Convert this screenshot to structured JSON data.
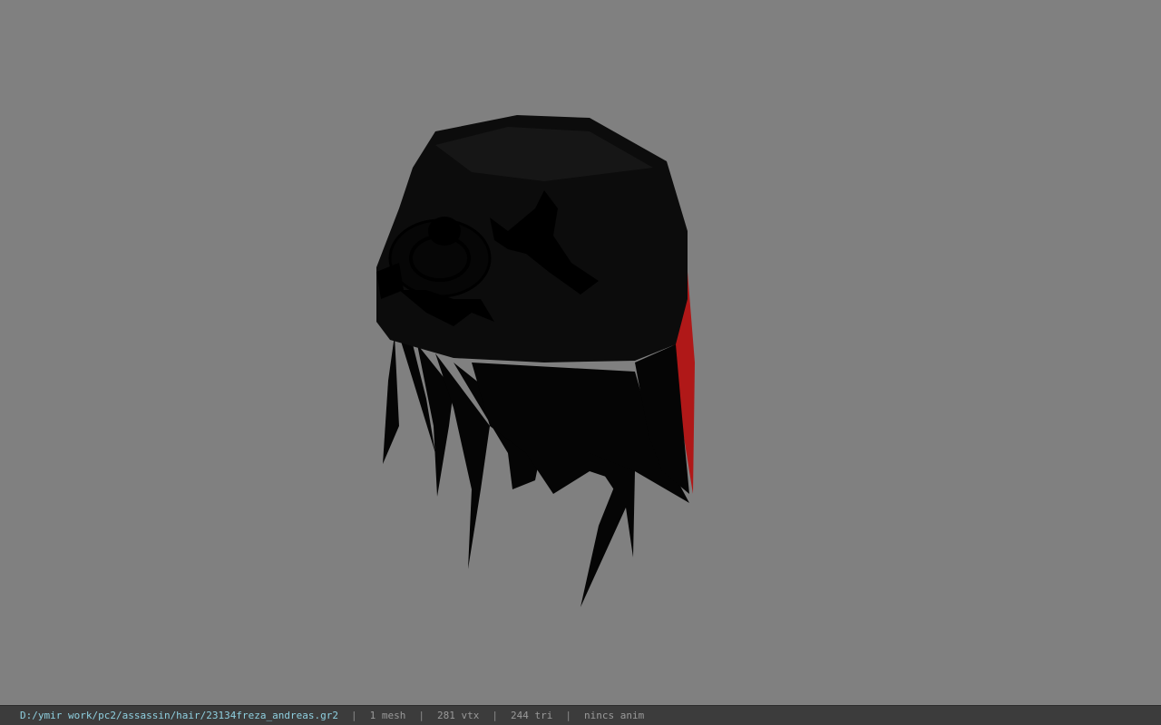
{
  "viewport": {
    "background_color": "#808080",
    "model_colors": {
      "cap": "#0c0c0c",
      "hair": "#050505",
      "accent_strand": "#b01818",
      "emblem": "#000000"
    }
  },
  "status_bar": {
    "file_path": "D:/ymir work/pc2/assassin/hair/23134freza_andreas.gr2",
    "separator": "|",
    "mesh_count": "1 mesh",
    "vertex_count": "281 vtx",
    "triangle_count": "244 tri",
    "anim_status": "nincs anim",
    "path_color": "#8fd0e0",
    "text_color": "#9a9a9a"
  }
}
